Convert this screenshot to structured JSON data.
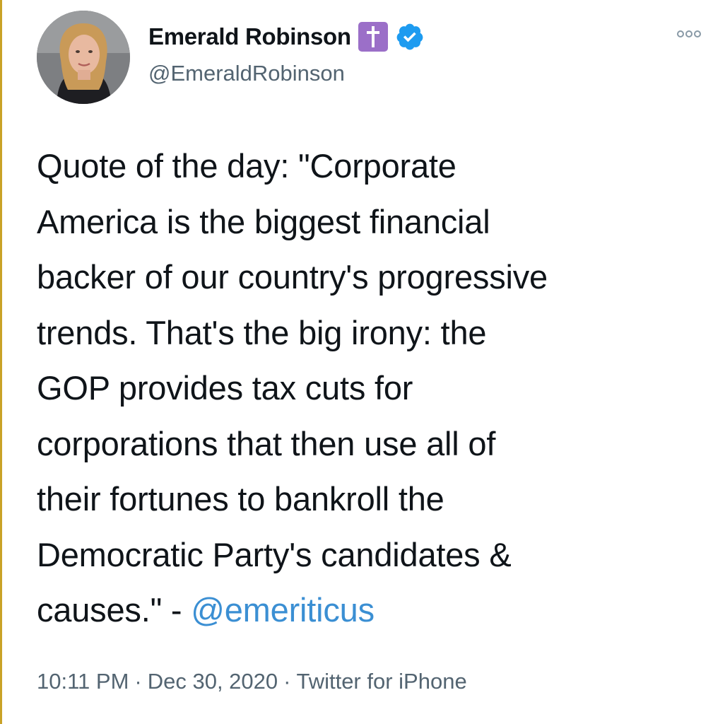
{
  "author": {
    "display_name": "Emerald Robinson",
    "handle": "@EmeraldRobinson",
    "badges": [
      "cross-icon",
      "verified-icon"
    ]
  },
  "tweet": {
    "lines": [
      "Quote of the day: \"Corporate",
      "America is the biggest financial",
      "backer of our country's progressive",
      "trends. That's the big irony: the",
      "GOP provides tax cuts for",
      "corporations that then use all of",
      "their fortunes to bankroll the",
      "Democratic Party's candidates &"
    ],
    "last_line_prefix": "causes.\" - ",
    "mention": "@emeriticus"
  },
  "meta": {
    "time": "10:11 PM",
    "date": "Dec 30, 2020",
    "source": "Twitter for iPhone",
    "separator": "·"
  },
  "colors": {
    "text": "#0f1419",
    "secondary": "#536471",
    "link": "#3b8fd3",
    "verified": "#1d9bf0",
    "cross_badge": "#9b6fc8"
  }
}
